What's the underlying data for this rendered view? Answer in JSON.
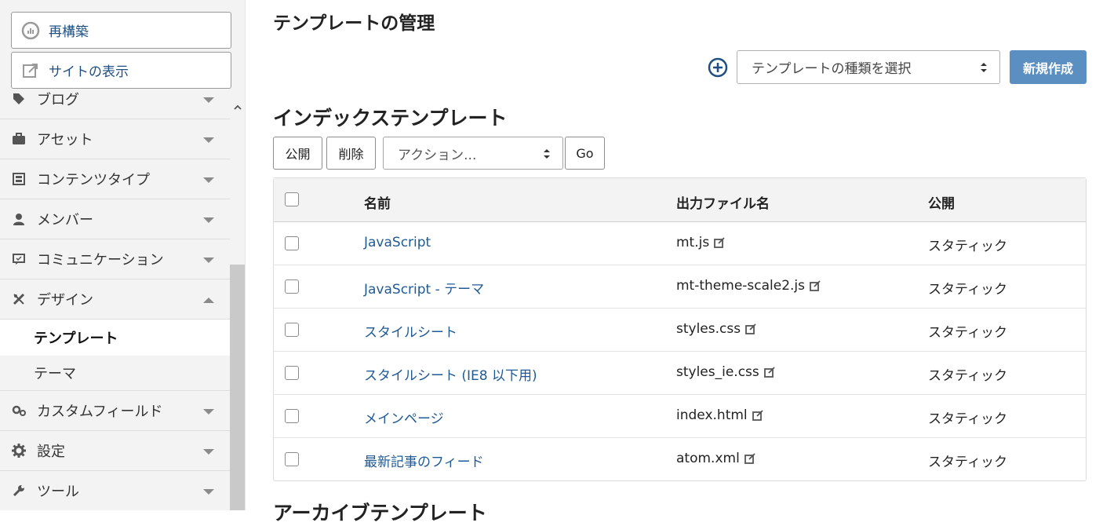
{
  "sidebar": {
    "rebuild_label": "再構築",
    "view_site_label": "サイトの表示",
    "items": [
      {
        "label": "ブログ",
        "icon": "tag-icon"
      },
      {
        "label": "アセット",
        "icon": "briefcase-icon"
      },
      {
        "label": "コンテンツタイプ",
        "icon": "content-type-icon"
      },
      {
        "label": "メンバー",
        "icon": "user-icon"
      },
      {
        "label": "コミュニケーション",
        "icon": "comment-icon"
      },
      {
        "label": "デザイン",
        "icon": "design-icon"
      },
      {
        "label": "カスタムフィールド",
        "icon": "custom-field-icon"
      },
      {
        "label": "設定",
        "icon": "gear-icon"
      },
      {
        "label": "ツール",
        "icon": "wrench-icon"
      }
    ],
    "design_sub": [
      {
        "label": "テンプレート",
        "active": true
      },
      {
        "label": "テーマ",
        "active": false
      }
    ]
  },
  "main": {
    "title": "テンプレートの管理",
    "type_select_label": "テンプレートの種類を選択",
    "new_button": "新規作成",
    "section_title": "インデックステンプレート",
    "section_title2": "アーカイブテンプレート",
    "publish_button": "公開",
    "delete_button": "削除",
    "action_select": "アクション...",
    "go_button": "Go",
    "columns": {
      "name": "名前",
      "file": "出力ファイル名",
      "publish": "公開"
    },
    "rows": [
      {
        "name": "JavaScript",
        "file": "mt.js",
        "publish": "スタティック"
      },
      {
        "name": "JavaScript - テーマ",
        "file": "mt-theme-scale2.js",
        "publish": "スタティック"
      },
      {
        "name": "スタイルシート",
        "file": "styles.css",
        "publish": "スタティック"
      },
      {
        "name": "スタイルシート (IE8 以下用)",
        "file": "styles_ie.css",
        "publish": "スタティック"
      },
      {
        "name": "メインページ",
        "file": "index.html",
        "publish": "スタティック"
      },
      {
        "name": "最新記事のフィード",
        "file": "atom.xml",
        "publish": "スタティック"
      }
    ]
  },
  "colors": {
    "link": "#1f5a96",
    "primary_button": "#5b8fc2",
    "sidebar_bg": "#f3f3f3"
  }
}
